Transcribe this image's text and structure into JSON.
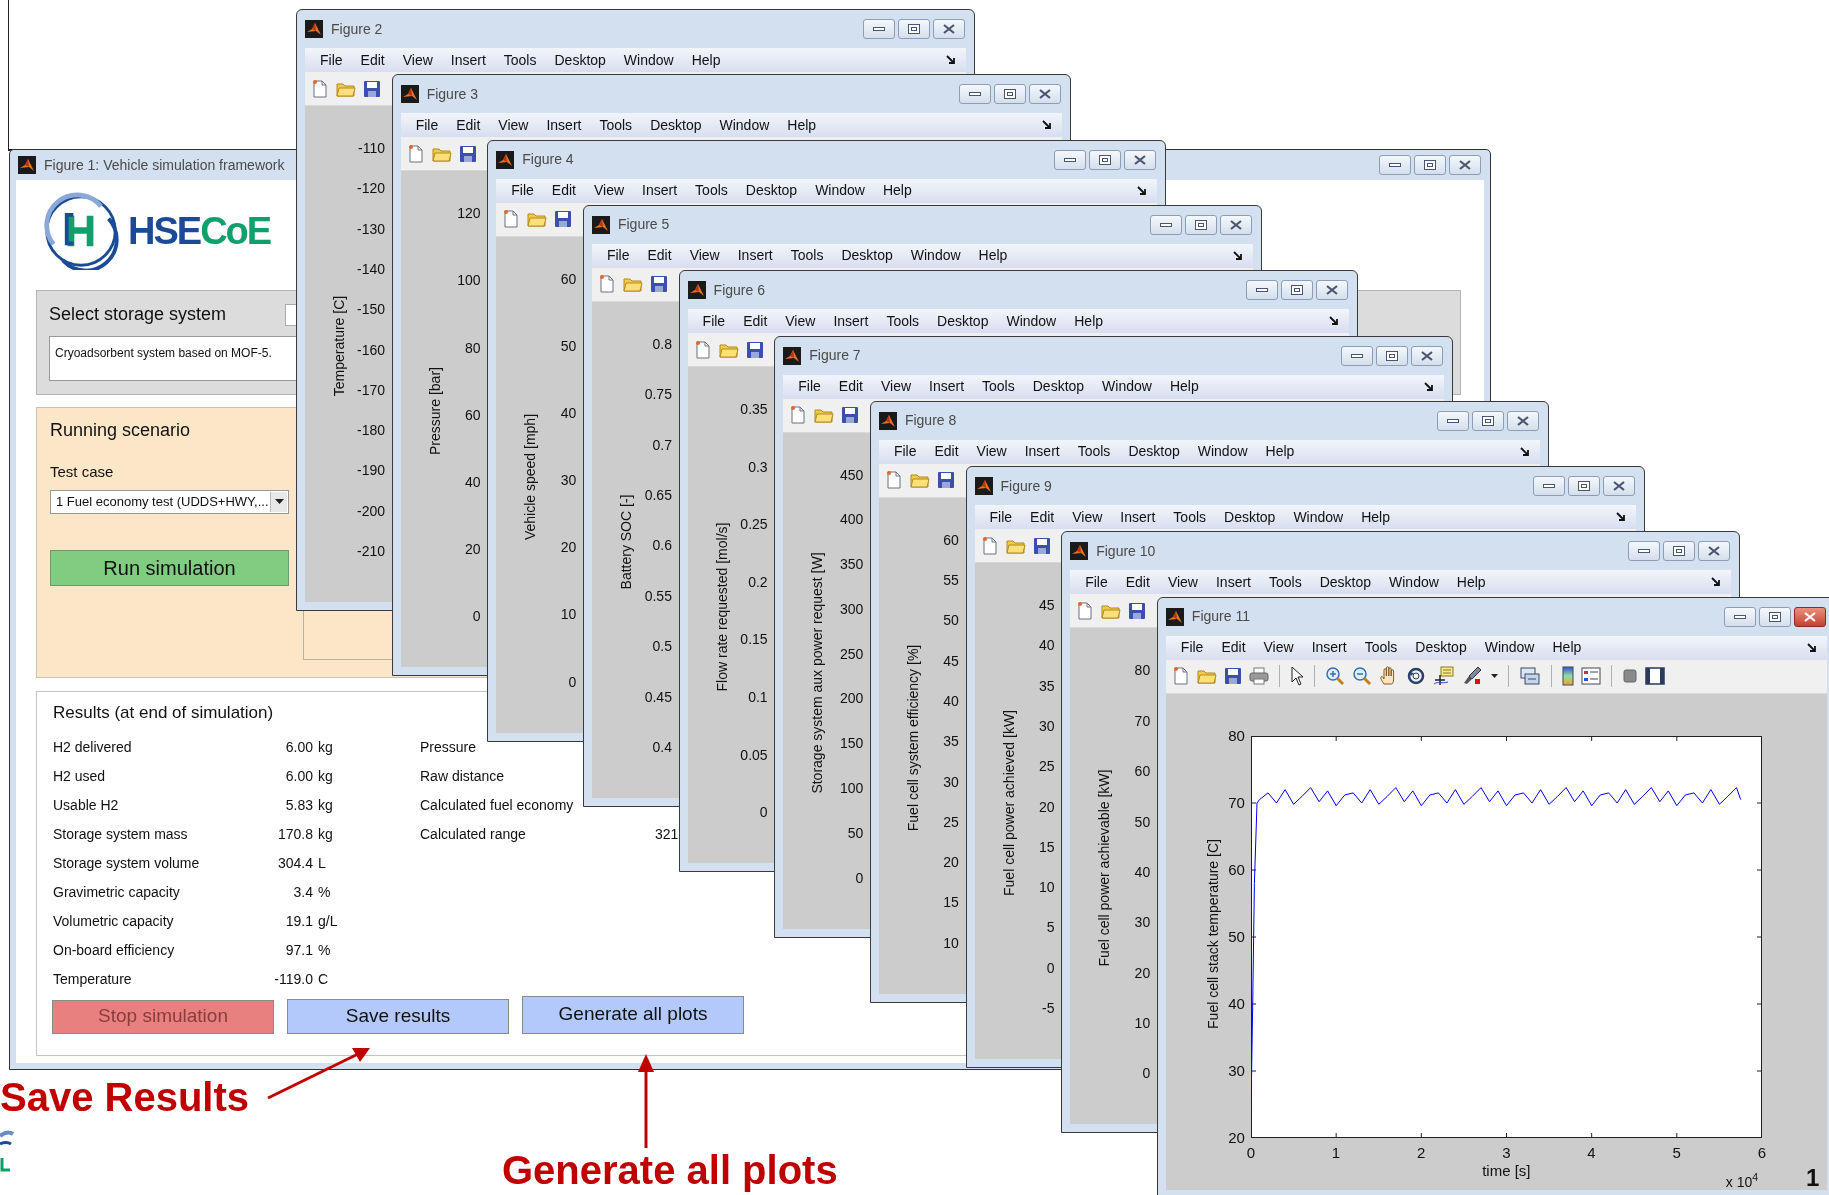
{
  "background_window": {
    "kind": "blank"
  },
  "main_window": {
    "title": "Figure 1: Vehicle simulation framework",
    "active": false,
    "logo": [
      {
        "text": "HSE",
        "color": "#1b4a96"
      },
      {
        "text": "CoE",
        "color": "#11a06c"
      }
    ],
    "storage_panel": {
      "title": "Select storage system",
      "description": "Cryoadsorbent system based on MOF-5."
    },
    "scenario_panel": {
      "title": "Running scenario",
      "test_case_label": "Test case",
      "test_case_value": "1  Fuel economy test (UDDS+HWY,...",
      "run_button": "Run simulation"
    },
    "results_panel": {
      "title": "Results (at end of simulation)",
      "left_rows": [
        {
          "label": "H2 delivered",
          "value": "6.00",
          "unit": "kg"
        },
        {
          "label": "H2 used",
          "value": "6.00",
          "unit": "kg"
        },
        {
          "label": "Usable H2",
          "value": "5.83",
          "unit": "kg"
        },
        {
          "label": "Storage system mass",
          "value": "170.8",
          "unit": "kg"
        },
        {
          "label": "Storage system volume",
          "value": "304.4",
          "unit": "L"
        },
        {
          "label": "Gravimetric capacity",
          "value": "3.4",
          "unit": "%"
        },
        {
          "label": "Volumetric capacity",
          "value": "19.1",
          "unit": "g/L"
        },
        {
          "label": "On-board efficiency",
          "value": "97.1",
          "unit": "%"
        },
        {
          "label": "Temperature",
          "value": "-119.0",
          "unit": "C"
        }
      ],
      "right_rows": [
        {
          "label": "Pressure"
        },
        {
          "label": "Raw distance"
        },
        {
          "label": "Calculated fuel economy"
        },
        {
          "label": "Calculated range",
          "value": "321"
        }
      ],
      "buttons": [
        {
          "label": "Stop simulation",
          "color": "#e88080",
          "disabled": true
        },
        {
          "label": "Save results",
          "color": "#b3c9fb",
          "disabled": false
        },
        {
          "label": "Generate all plots",
          "color": "#b3c9fb",
          "disabled": false
        }
      ]
    }
  },
  "figures": [
    {
      "kind": "axis",
      "title": "Figure 2",
      "active": false,
      "menu": [
        "File",
        "Edit",
        "View",
        "Insert",
        "Tools",
        "Desktop",
        "Window",
        "Help"
      ],
      "y_label": "Temperature [C]",
      "y_ticks": [
        "-110",
        "-120",
        "-130",
        "-140",
        "-150",
        "-160",
        "-170",
        "-180",
        "-190",
        "-200",
        "-210"
      ]
    },
    {
      "kind": "axis",
      "title": "Figure 3",
      "active": false,
      "menu": [
        "File",
        "Edit",
        "View",
        "Insert",
        "Tools",
        "Desktop",
        "Window",
        "Help"
      ],
      "y_label": "Pressure [bar]",
      "y_ticks": [
        "120",
        "100",
        "80",
        "60",
        "40",
        "20",
        "0"
      ]
    },
    {
      "kind": "axis",
      "title": "Figure 4",
      "active": false,
      "menu": [
        "File",
        "Edit",
        "View",
        "Insert",
        "Tools",
        "Desktop",
        "Window",
        "Help"
      ],
      "y_label": "Vehicle speed [mph]",
      "y_ticks": [
        "60",
        "50",
        "40",
        "30",
        "20",
        "10",
        "0"
      ]
    },
    {
      "kind": "axis",
      "title": "Figure 5",
      "active": false,
      "menu": [
        "File",
        "Edit",
        "View",
        "Insert",
        "Tools",
        "Desktop",
        "Window",
        "Help"
      ],
      "y_label": "Battery SOC [-]",
      "y_ticks": [
        "0.8",
        "0.75",
        "0.7",
        "0.65",
        "0.6",
        "0.55",
        "0.5",
        "0.45",
        "0.4"
      ]
    },
    {
      "kind": "axis",
      "title": "Figure 6",
      "active": false,
      "menu": [
        "File",
        "Edit",
        "View",
        "Insert",
        "Tools",
        "Desktop",
        "Window",
        "Help"
      ],
      "y_label": "Flow rate requested [mol/s]",
      "y_ticks": [
        "0.35",
        "0.3",
        "0.25",
        "0.2",
        "0.15",
        "0.1",
        "0.05",
        "0"
      ]
    },
    {
      "kind": "axis",
      "title": "Figure 7",
      "active": false,
      "menu": [
        "File",
        "Edit",
        "View",
        "Insert",
        "Tools",
        "Desktop",
        "Window",
        "Help"
      ],
      "y_label": "Storage system aux power request [W]",
      "y_ticks": [
        "450",
        "400",
        "350",
        "300",
        "250",
        "200",
        "150",
        "100",
        "50",
        "0"
      ]
    },
    {
      "kind": "axis",
      "title": "Figure 8",
      "active": false,
      "menu": [
        "File",
        "Edit",
        "View",
        "Insert",
        "Tools",
        "Desktop",
        "Window",
        "Help"
      ],
      "y_label": "Fuel cell system efficiency [%]",
      "y_ticks": [
        "60",
        "55",
        "50",
        "45",
        "40",
        "35",
        "30",
        "25",
        "20",
        "15",
        "10"
      ]
    },
    {
      "kind": "axis",
      "title": "Figure 9",
      "active": false,
      "menu": [
        "File",
        "Edit",
        "View",
        "Insert",
        "Tools",
        "Desktop",
        "Window",
        "Help"
      ],
      "y_label": "Fuel cell power achieved [kW]",
      "y_ticks": [
        "45",
        "40",
        "35",
        "30",
        "25",
        "20",
        "15",
        "10",
        "5",
        "0",
        "-5"
      ]
    },
    {
      "kind": "axis",
      "title": "Figure 10",
      "active": false,
      "menu": [
        "File",
        "Edit",
        "View",
        "Insert",
        "Tools",
        "Desktop",
        "Window",
        "Help"
      ],
      "y_label": "Fuel cell power achievable [kW]",
      "y_ticks": [
        "80",
        "70",
        "60",
        "50",
        "40",
        "30",
        "20",
        "10",
        "0"
      ]
    },
    {
      "kind": "plot",
      "title": "Figure 11",
      "active": true,
      "menu": [
        "File",
        "Edit",
        "View",
        "Insert",
        "Tools",
        "Desktop",
        "Window",
        "Help"
      ],
      "x_multiplier": "x 10$^{4}$",
      "chart_data": {
        "type": "line",
        "xlabel": "time [s]",
        "ylabel": "Fuel cell stack temperature [C]",
        "xlim": [
          0,
          6
        ],
        "ylim": [
          20,
          80
        ],
        "xticks": [
          0,
          1,
          2,
          3,
          4,
          5,
          6
        ],
        "yticks": [
          20,
          30,
          40,
          50,
          60,
          70,
          80
        ],
        "x": [
          0,
          0.02,
          0.04,
          0.07,
          0.1,
          0.2,
          0.3,
          0.4,
          0.5,
          0.6,
          0.7,
          0.8,
          0.9,
          1.0,
          1.1,
          1.2,
          1.3,
          1.4,
          1.5,
          1.6,
          1.7,
          1.8,
          1.9,
          2.0,
          2.1,
          2.2,
          2.3,
          2.4,
          2.5,
          2.6,
          2.7,
          2.8,
          2.9,
          3.0,
          3.1,
          3.2,
          3.3,
          3.4,
          3.5,
          3.6,
          3.7,
          3.8,
          3.9,
          4.0,
          4.1,
          4.2,
          4.3,
          4.4,
          4.5,
          4.6,
          4.7,
          4.8,
          4.9,
          5.0,
          5.1,
          5.2,
          5.3,
          5.4,
          5.5,
          5.6,
          5.7,
          5.75
        ],
        "series": [
          {
            "color": "#0000ff",
            "values": [
              24,
              40,
              58,
              70,
              70.5,
              71.5,
              70.0,
              72.0,
              69.8,
              71.0,
              72.3,
              70.2,
              71.8,
              69.6,
              71.2,
              71.5,
              70.0,
              72.0,
              69.8,
              71.0,
              72.3,
              70.2,
              71.8,
              69.6,
              71.2,
              71.5,
              70.0,
              72.0,
              69.8,
              71.0,
              72.3,
              70.2,
              71.8,
              69.6,
              71.2,
              71.5,
              70.0,
              72.0,
              69.8,
              71.0,
              72.3,
              70.2,
              71.8,
              69.6,
              71.2,
              71.5,
              70.0,
              72.0,
              69.8,
              71.0,
              72.3,
              70.2,
              71.8,
              69.6,
              71.2,
              71.5,
              70.0,
              72.0,
              69.8,
              71.0,
              72.3,
              70.5
            ]
          }
        ]
      }
    }
  ],
  "annotations": [
    {
      "text": "Save Results"
    },
    {
      "text": "Generate all plots"
    }
  ],
  "slide_number": "1"
}
